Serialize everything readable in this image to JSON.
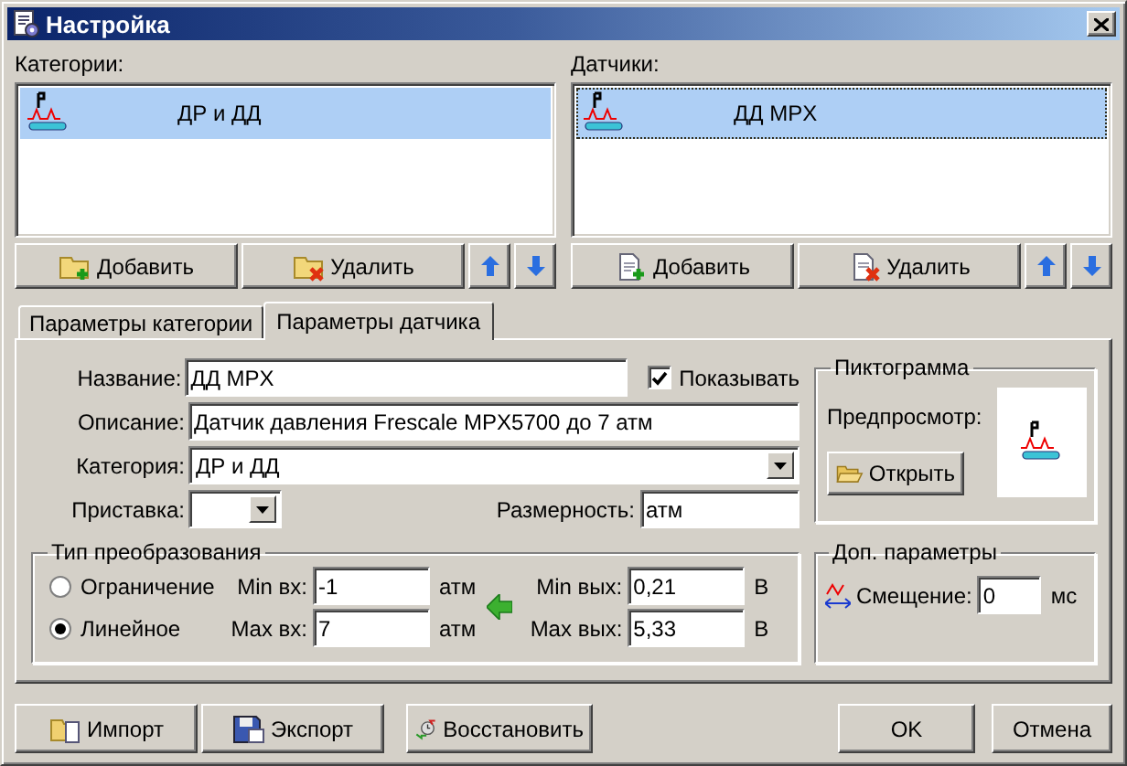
{
  "window": {
    "title": "Настройка"
  },
  "lists": [
    {
      "label": "Категории:",
      "items": [
        {
          "text": "ДР и ДД",
          "selected": true,
          "focused": false
        }
      ],
      "buttons": [
        {
          "kind": "add",
          "label": "Добавить"
        },
        {
          "kind": "remove",
          "label": "Удалить"
        },
        {
          "kind": "up"
        },
        {
          "kind": "down"
        }
      ]
    },
    {
      "label": "Датчики:",
      "items": [
        {
          "text": "ДД MPX",
          "selected": true,
          "focused": true
        }
      ],
      "buttons": [
        {
          "kind": "add",
          "label": "Добавить"
        },
        {
          "kind": "remove",
          "label": "Удалить"
        },
        {
          "kind": "up"
        },
        {
          "kind": "down"
        }
      ]
    }
  ],
  "tabs": [
    {
      "label": "Параметры категории",
      "selected": false
    },
    {
      "label": "Параметры датчика",
      "selected": true
    }
  ],
  "form": {
    "name": {
      "label": "Название:",
      "value": "ДД MPX"
    },
    "show": {
      "label": "Показывать",
      "checked": true
    },
    "description": {
      "label": "Описание:",
      "value": "Датчик давления Frescale MPX5700 до 7 атм"
    },
    "category": {
      "label": "Категория:",
      "value": "ДР и ДД"
    },
    "prefix": {
      "label": "Приставка:"
    },
    "dimension": {
      "label": "Размерность:",
      "value": "атм"
    }
  },
  "pictogram": {
    "title": "Пиктограмма",
    "preview_label": "Предпросмотр:",
    "open_button": "Открыть"
  },
  "conversion": {
    "title": "Тип преобразования",
    "options": [
      {
        "label": "Ограничение",
        "selected": false
      },
      {
        "label": "Линейное",
        "selected": true
      }
    ],
    "inputs": [
      {
        "label": "Min вх:",
        "value": "-1",
        "unit": "атм"
      },
      {
        "label": "Max вх:",
        "value": "7",
        "unit": "атм"
      }
    ],
    "outputs": [
      {
        "label": "Min вых:",
        "value": "0,21",
        "unit": "В"
      },
      {
        "label": "Max вых:",
        "value": "5,33",
        "unit": "В"
      }
    ]
  },
  "extra": {
    "title": "Доп. параметры",
    "offset": {
      "label": "Смещение:",
      "value": "0",
      "unit": "мс"
    }
  },
  "footer": {
    "left": [
      {
        "kind": "import",
        "label": "Импорт"
      },
      {
        "kind": "export",
        "label": "Экспорт"
      },
      {
        "kind": "restore",
        "label": "Восстановить"
      }
    ],
    "right": [
      {
        "kind": "ok",
        "label": "OK"
      },
      {
        "kind": "cancel",
        "label": "Отмена"
      }
    ]
  }
}
